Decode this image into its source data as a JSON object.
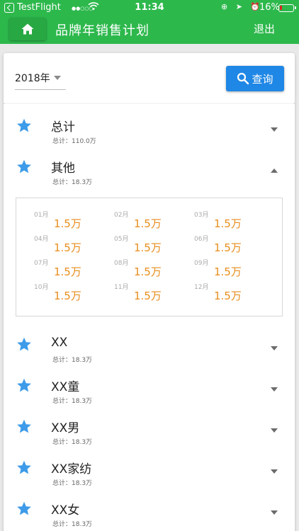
{
  "status_bar": {
    "app": "TestFlight",
    "signal": "●●○○○",
    "time": "11:34",
    "icons": "⊕ ➤ ⏰",
    "battery": "16%",
    "battery_level": 0.16,
    "battery_color": "#e0231f"
  },
  "app_bar": {
    "title": "品牌年销售计划",
    "logout_label": "退出",
    "color": "#2db84c"
  },
  "filter": {
    "year": "2018年",
    "query_label": "查询",
    "button_color": "#1f87e5"
  },
  "items": [
    {
      "name": "总计",
      "total": "总计：110.0万",
      "expanded": false
    },
    {
      "name": "其他",
      "total": "总计：18.3万",
      "expanded": true
    },
    {
      "name": "XX",
      "total": "总计：18.3万",
      "expanded": false
    },
    {
      "name": "XX童",
      "total": "总计：18.3万",
      "expanded": false
    },
    {
      "name": "XX男",
      "total": "总计：18.3万",
      "expanded": false
    },
    {
      "name": "XX家纺",
      "total": "总计：18.3万",
      "expanded": false
    },
    {
      "name": "XX女",
      "total": "总计：18.3万",
      "expanded": false
    }
  ],
  "months": [
    {
      "label": "01月",
      "value": "1.5万"
    },
    {
      "label": "02月",
      "value": "1.5万"
    },
    {
      "label": "03月",
      "value": "1.5万"
    },
    {
      "label": "04月",
      "value": "1.5万"
    },
    {
      "label": "05月",
      "value": "1.5万"
    },
    {
      "label": "06月",
      "value": "1.5万"
    },
    {
      "label": "07月",
      "value": "1.5万"
    },
    {
      "label": "08月",
      "value": "1.5万"
    },
    {
      "label": "09月",
      "value": "1.5万"
    },
    {
      "label": "10月",
      "value": "1.5万"
    },
    {
      "label": "11月",
      "value": "1.5万"
    },
    {
      "label": "12月",
      "value": "1.5万"
    }
  ],
  "colors": {
    "star": "#3d9be9",
    "month_value": "#e88d1b"
  }
}
